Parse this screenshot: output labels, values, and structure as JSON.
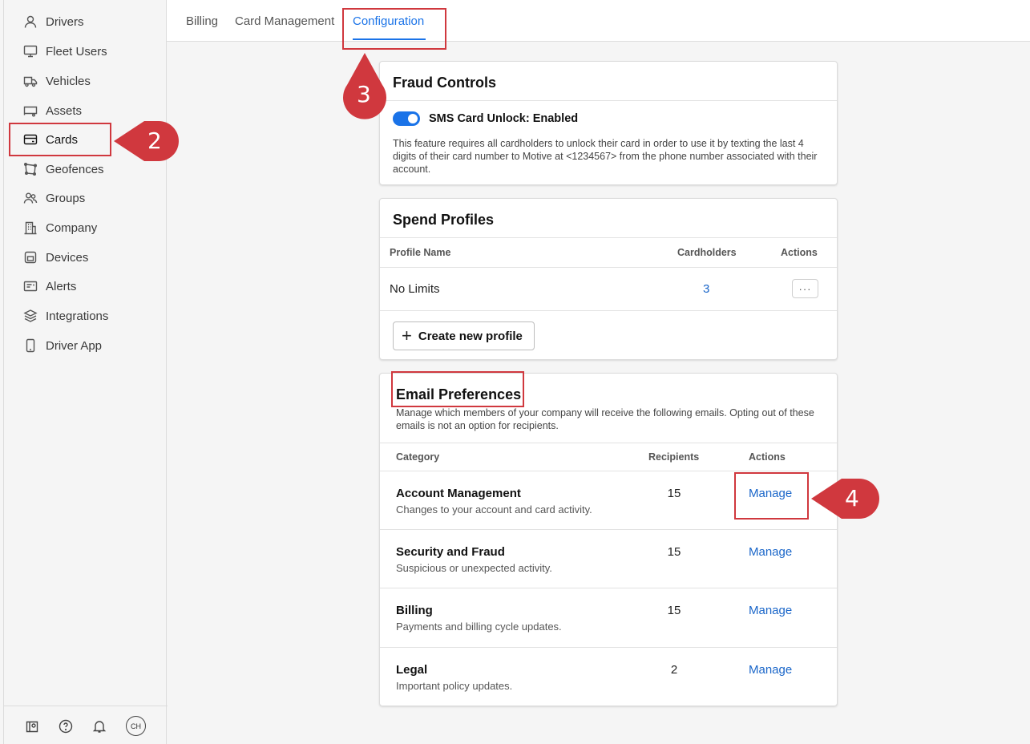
{
  "sidebar": {
    "items": [
      {
        "label": "Drivers",
        "icon": "person-icon"
      },
      {
        "label": "Fleet Users",
        "icon": "monitor-icon"
      },
      {
        "label": "Vehicles",
        "icon": "truck-icon"
      },
      {
        "label": "Assets",
        "icon": "trailer-icon"
      },
      {
        "label": "Cards",
        "icon": "card-icon"
      },
      {
        "label": "Geofences",
        "icon": "geofence-icon"
      },
      {
        "label": "Groups",
        "icon": "groups-icon"
      },
      {
        "label": "Company",
        "icon": "building-icon"
      },
      {
        "label": "Devices",
        "icon": "device-icon"
      },
      {
        "label": "Alerts",
        "icon": "alert-icon"
      },
      {
        "label": "Integrations",
        "icon": "layers-icon"
      },
      {
        "label": "Driver App",
        "icon": "phone-icon"
      }
    ],
    "active": "Cards",
    "avatar": "CH"
  },
  "tabs": [
    "Billing",
    "Card Management",
    "Configuration"
  ],
  "active_tab": "Configuration",
  "fraud": {
    "title": "Fraud Controls",
    "toggle_label": "SMS Card Unlock: Enabled",
    "toggle_on": true,
    "description": "This feature requires all cardholders to unlock their card in order to use it by texting the last 4 digits of their card number to Motive at <1234567> from the phone number associated with their account."
  },
  "spend": {
    "title": "Spend Profiles",
    "columns": [
      "Profile Name",
      "Cardholders",
      "Actions"
    ],
    "rows": [
      {
        "name": "No Limits",
        "cardholders": "3",
        "action": "···"
      }
    ],
    "create_label": "Create new profile"
  },
  "email": {
    "title": "Email Preferences",
    "description": "Manage which members of your company will receive the following emails. Opting out of these emails is not an option for recipients.",
    "columns": [
      "Category",
      "Recipients",
      "Actions"
    ],
    "rows": [
      {
        "title": "Account Management",
        "sub": "Changes to your account and card activity.",
        "recipients": "15",
        "action": "Manage"
      },
      {
        "title": "Security and Fraud",
        "sub": "Suspicious or unexpected activity.",
        "recipients": "15",
        "action": "Manage"
      },
      {
        "title": "Billing",
        "sub": "Payments and billing cycle updates.",
        "recipients": "15",
        "action": "Manage"
      },
      {
        "title": "Legal",
        "sub": "Important policy updates.",
        "recipients": "2",
        "action": "Manage"
      }
    ]
  },
  "annotations": {
    "step2": "2",
    "step3": "3",
    "step4": "4"
  },
  "colors": {
    "accent": "#1a73e8",
    "annotation": "#d0383e"
  }
}
